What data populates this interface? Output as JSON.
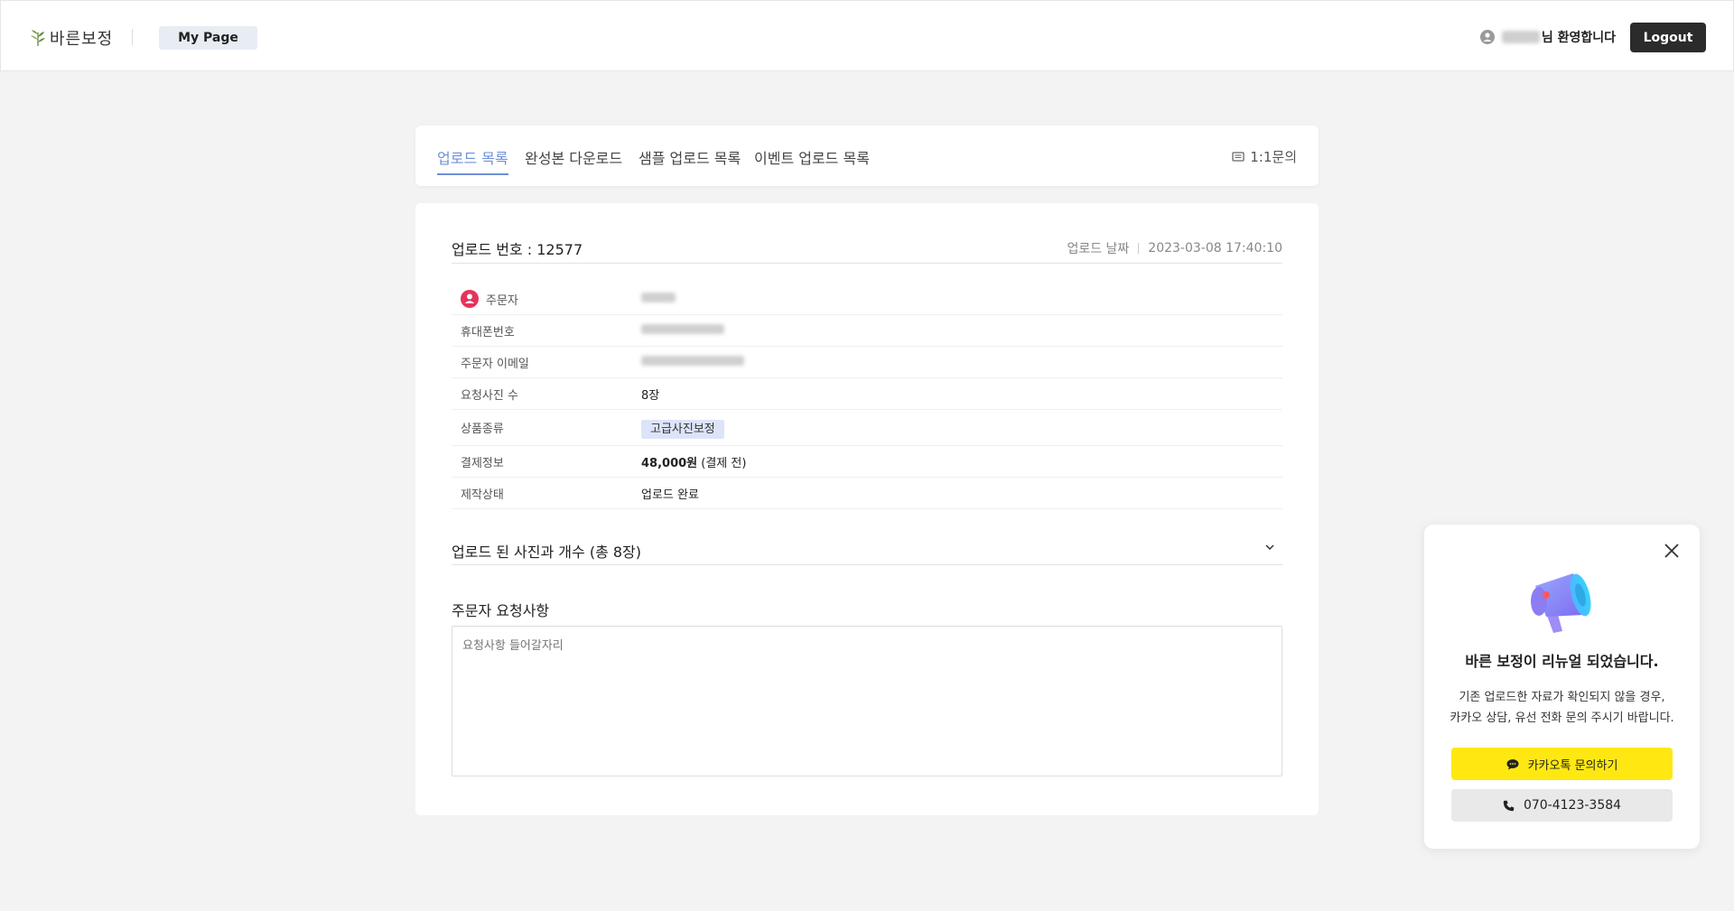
{
  "header": {
    "logo_text": "바른보정",
    "mypage_label": "My Page",
    "welcome_suffix": "님 환영합니다",
    "logout_label": "Logout"
  },
  "tabs": {
    "items": [
      {
        "label": "업로드 목록",
        "active": true
      },
      {
        "label": "완성본 다운로드",
        "active": false
      },
      {
        "label": "샘플 업로드 목록",
        "active": false
      },
      {
        "label": "이벤트 업로드 목록",
        "active": false
      }
    ],
    "inquiry_label": "1:1문의"
  },
  "upload": {
    "title": "업로드 번호 : 12577",
    "date_label": "업로드 날짜",
    "date_value": "2023-03-08 17:40:10",
    "rows": [
      {
        "label": "주문자",
        "value": ""
      },
      {
        "label": "휴대폰번호",
        "value": ""
      },
      {
        "label": "주문자 이메일",
        "value": ""
      },
      {
        "label": "요청사진 수",
        "value": "8장"
      },
      {
        "label": "상품종류",
        "value": "고급사진보정"
      },
      {
        "label": "결제정보",
        "value_bold": "48,000원",
        "value_rest": " (결제 전)"
      },
      {
        "label": "제작상태",
        "value": "업로드 완료"
      }
    ],
    "photos_title": "업로드 된 사진과 개수 (총 8장)",
    "request_title": "주문자 요청사항",
    "request_placeholder": "요청사항 들어갈자리"
  },
  "popup": {
    "title": "바른 보정이 리뉴얼 되었습니다.",
    "desc_line1": "기존 업로드한 자료가 확인되지 않을 경우,",
    "desc_line2": "카카오 상담, 유선 전화 문의 주시기 바랍니다.",
    "kakao_label": "카카오톡 문의하기",
    "phone_label": "070-4123-3584"
  },
  "colors": {
    "accent": "#6f8fd8",
    "kakao": "#ffe812",
    "dark_button": "#2b2b2b"
  }
}
